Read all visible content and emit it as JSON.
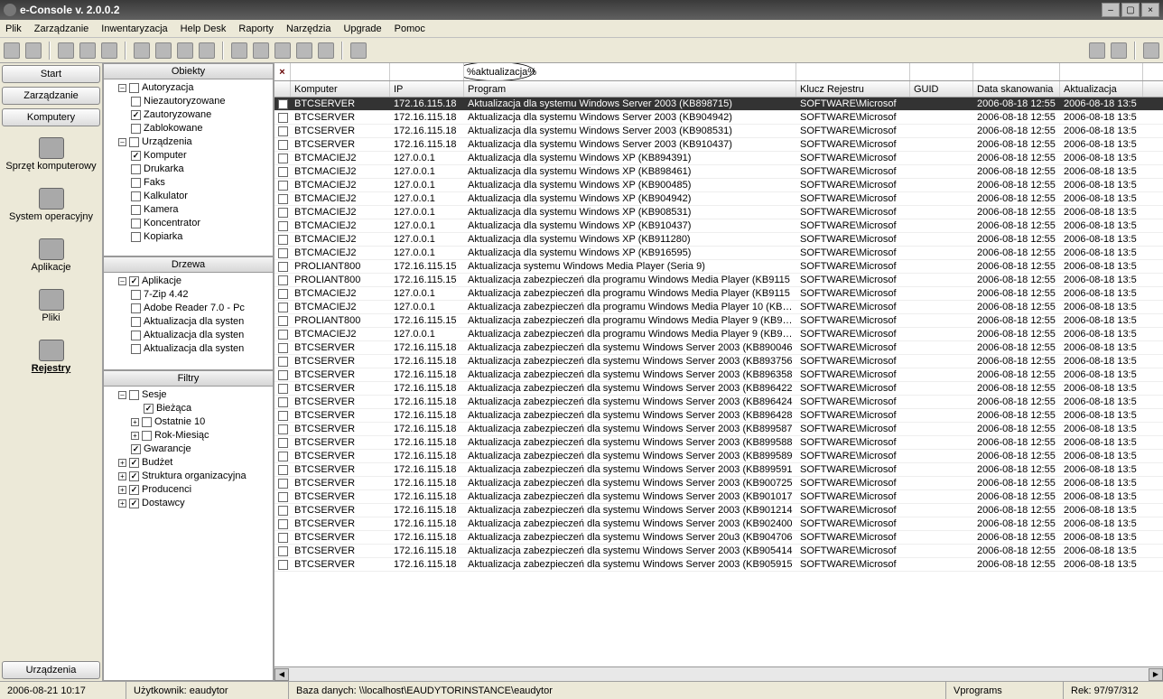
{
  "title": "e-Console v. 2.0.0.2",
  "menu": [
    "Plik",
    "Zarządzanie",
    "Inwentaryzacja",
    "Help Desk",
    "Raporty",
    "Narzędzia",
    "Upgrade",
    "Pomoc"
  ],
  "leftButtons": {
    "start": "Start",
    "zarz": "Zarządzanie",
    "komp": "Komputery",
    "urz": "Urządzenia"
  },
  "leftBig": [
    {
      "id": "sprzet",
      "label": "Sprzęt komputerowy"
    },
    {
      "id": "system",
      "label": "System operacyjny"
    },
    {
      "id": "aplikacje",
      "label": "Aplikacje"
    },
    {
      "id": "pliki",
      "label": "Pliki"
    },
    {
      "id": "rejestry",
      "label": "Rejestry",
      "selected": true
    }
  ],
  "panels": {
    "obiekty": {
      "title": "Obiekty",
      "root": "Autoryzacja",
      "authItems": [
        {
          "label": "Niezautoryzowane",
          "on": false
        },
        {
          "label": "Zautoryzowane",
          "on": true
        },
        {
          "label": "Zablokowane",
          "on": false
        }
      ],
      "urz": "Urządzenia",
      "urzItems": [
        {
          "label": "Komputer",
          "on": true
        },
        {
          "label": "Drukarka",
          "on": false
        },
        {
          "label": "Faks",
          "on": false
        },
        {
          "label": "Kalkulator",
          "on": false
        },
        {
          "label": "Kamera",
          "on": false
        },
        {
          "label": "Koncentrator",
          "on": false
        },
        {
          "label": "Kopiarka",
          "on": false
        }
      ]
    },
    "drzewa": {
      "title": "Drzewa",
      "root": "Aplikacje",
      "items": [
        {
          "label": "7-Zip 4.42",
          "on": false
        },
        {
          "label": "Adobe Reader 7.0 - Pc",
          "on": false
        },
        {
          "label": "Aktualizacja dla systen",
          "on": false
        },
        {
          "label": "Aktualizacja dla systen",
          "on": false
        },
        {
          "label": "Aktualizacja dla systen",
          "on": false
        }
      ]
    },
    "filtry": {
      "title": "Filtry",
      "sesje": "Sesje",
      "sesItems": [
        {
          "label": "Bieżąca",
          "on": true,
          "leaf": true
        },
        {
          "label": "Ostatnie 10",
          "on": false,
          "exp": "+"
        },
        {
          "label": "Rok-Miesiąc",
          "on": false,
          "exp": "+"
        }
      ],
      "rest": [
        {
          "label": "Gwarancje",
          "on": true,
          "exp": ""
        },
        {
          "label": "Budżet",
          "on": true,
          "exp": "+"
        },
        {
          "label": "Struktura organizacyjna",
          "on": true,
          "exp": "+"
        },
        {
          "label": "Producenci",
          "on": true,
          "exp": "+"
        },
        {
          "label": "Dostawcy",
          "on": true,
          "exp": "+"
        }
      ]
    }
  },
  "filterVal": "%aktualizacja%",
  "columns": [
    "Komputer",
    "IP",
    "Program",
    "Klucz Rejestru",
    "GUID",
    "Data skanowania",
    "Aktualizacja"
  ],
  "rows": [
    {
      "sel": true,
      "c": [
        "BTCSERVER",
        "172.16.115.18",
        "Aktualizacja dla systemu Windows Server 2003 (KB898715)",
        "SOFTWARE\\Microsof",
        "",
        "2006-08-18 12:55",
        "2006-08-18 13:5"
      ]
    },
    {
      "c": [
        "BTCSERVER",
        "172.16.115.18",
        "Aktualizacja dla systemu Windows Server 2003 (KB904942)",
        "SOFTWARE\\Microsof",
        "",
        "2006-08-18 12:55",
        "2006-08-18 13:5"
      ]
    },
    {
      "c": [
        "BTCSERVER",
        "172.16.115.18",
        "Aktualizacja dla systemu Windows Server 2003 (KB908531)",
        "SOFTWARE\\Microsof",
        "",
        "2006-08-18 12:55",
        "2006-08-18 13:5"
      ]
    },
    {
      "c": [
        "BTCSERVER",
        "172.16.115.18",
        "Aktualizacja dla systemu Windows Server 2003 (KB910437)",
        "SOFTWARE\\Microsof",
        "",
        "2006-08-18 12:55",
        "2006-08-18 13:5"
      ]
    },
    {
      "c": [
        "BTCMACIEJ2",
        "127.0.0.1",
        "Aktualizacja dla systemu Windows XP (KB894391)",
        "SOFTWARE\\Microsof",
        "",
        "2006-08-18 12:55",
        "2006-08-18 13:5"
      ]
    },
    {
      "c": [
        "BTCMACIEJ2",
        "127.0.0.1",
        "Aktualizacja dla systemu Windows XP (KB898461)",
        "SOFTWARE\\Microsof",
        "",
        "2006-08-18 12:55",
        "2006-08-18 13:5"
      ]
    },
    {
      "c": [
        "BTCMACIEJ2",
        "127.0.0.1",
        "Aktualizacja dla systemu Windows XP (KB900485)",
        "SOFTWARE\\Microsof",
        "",
        "2006-08-18 12:55",
        "2006-08-18 13:5"
      ]
    },
    {
      "c": [
        "BTCMACIEJ2",
        "127.0.0.1",
        "Aktualizacja dla systemu Windows XP (KB904942)",
        "SOFTWARE\\Microsof",
        "",
        "2006-08-18 12:55",
        "2006-08-18 13:5"
      ]
    },
    {
      "c": [
        "BTCMACIEJ2",
        "127.0.0.1",
        "Aktualizacja dla systemu Windows XP (KB908531)",
        "SOFTWARE\\Microsof",
        "",
        "2006-08-18 12:55",
        "2006-08-18 13:5"
      ]
    },
    {
      "c": [
        "BTCMACIEJ2",
        "127.0.0.1",
        "Aktualizacja dla systemu Windows XP (KB910437)",
        "SOFTWARE\\Microsof",
        "",
        "2006-08-18 12:55",
        "2006-08-18 13:5"
      ]
    },
    {
      "c": [
        "BTCMACIEJ2",
        "127.0.0.1",
        "Aktualizacja dla systemu Windows XP (KB911280)",
        "SOFTWARE\\Microsof",
        "",
        "2006-08-18 12:55",
        "2006-08-18 13:5"
      ]
    },
    {
      "c": [
        "BTCMACIEJ2",
        "127.0.0.1",
        "Aktualizacja dla systemu Windows XP (KB916595)",
        "SOFTWARE\\Microsof",
        "",
        "2006-08-18 12:55",
        "2006-08-18 13:5"
      ]
    },
    {
      "c": [
        "PROLIANT800",
        "172.16.115.15",
        "Aktualizacja systemu Windows Media Player (Seria 9)",
        "SOFTWARE\\Microsof",
        "",
        "2006-08-18 12:55",
        "2006-08-18 13:5"
      ]
    },
    {
      "c": [
        "PROLIANT800",
        "172.16.115.15",
        "Aktualizacja zabezpieczeń dla programu Windows Media Player (KB9115",
        "SOFTWARE\\Microsof",
        "",
        "2006-08-18 12:55",
        "2006-08-18 13:5"
      ]
    },
    {
      "c": [
        "BTCMACIEJ2",
        "127.0.0.1",
        "Aktualizacja zabezpieczeń dla programu Windows Media Player (KB9115",
        "SOFTWARE\\Microsof",
        "",
        "2006-08-18 12:55",
        "2006-08-18 13:5"
      ]
    },
    {
      "c": [
        "BTCMACIEJ2",
        "127.0.0.1",
        "Aktualizacja zabezpieczeń dla programu Windows Media Player 10 (KB91",
        "SOFTWARE\\Microsof",
        "",
        "2006-08-18 12:55",
        "2006-08-18 13:5"
      ]
    },
    {
      "c": [
        "PROLIANT800",
        "172.16.115.15",
        "Aktualizacja zabezpieczeń dla programu Windows Media Player 9 (KB917",
        "SOFTWARE\\Microsof",
        "",
        "2006-08-18 12:55",
        "2006-08-18 13:5"
      ]
    },
    {
      "c": [
        "BTCMACIEJ2",
        "127.0.0.1",
        "Aktualizacja zabezpieczeń dla programu Windows Media Player 9 (KB917",
        "SOFTWARE\\Microsof",
        "",
        "2006-08-18 12:55",
        "2006-08-18 13:5"
      ]
    },
    {
      "c": [
        "BTCSERVER",
        "172.16.115.18",
        "Aktualizacja zabezpieczeń dla systemu Windows Server 2003 (KB890046",
        "SOFTWARE\\Microsof",
        "",
        "2006-08-18 12:55",
        "2006-08-18 13:5"
      ]
    },
    {
      "c": [
        "BTCSERVER",
        "172.16.115.18",
        "Aktualizacja zabezpieczeń dla systemu Windows Server 2003 (KB893756",
        "SOFTWARE\\Microsof",
        "",
        "2006-08-18 12:55",
        "2006-08-18 13:5"
      ]
    },
    {
      "c": [
        "BTCSERVER",
        "172.16.115.18",
        "Aktualizacja zabezpieczeń dla systemu Windows Server 2003 (KB896358",
        "SOFTWARE\\Microsof",
        "",
        "2006-08-18 12:55",
        "2006-08-18 13:5"
      ]
    },
    {
      "c": [
        "BTCSERVER",
        "172.16.115.18",
        "Aktualizacja zabezpieczeń dla systemu Windows Server 2003 (KB896422",
        "SOFTWARE\\Microsof",
        "",
        "2006-08-18 12:55",
        "2006-08-18 13:5"
      ]
    },
    {
      "c": [
        "BTCSERVER",
        "172.16.115.18",
        "Aktualizacja zabezpieczeń dla systemu Windows Server 2003 (KB896424",
        "SOFTWARE\\Microsof",
        "",
        "2006-08-18 12:55",
        "2006-08-18 13:5"
      ]
    },
    {
      "c": [
        "BTCSERVER",
        "172.16.115.18",
        "Aktualizacja zabezpieczeń dla systemu Windows Server 2003 (KB896428",
        "SOFTWARE\\Microsof",
        "",
        "2006-08-18 12:55",
        "2006-08-18 13:5"
      ]
    },
    {
      "c": [
        "BTCSERVER",
        "172.16.115.18",
        "Aktualizacja zabezpieczeń dla systemu Windows Server 2003 (KB899587",
        "SOFTWARE\\Microsof",
        "",
        "2006-08-18 12:55",
        "2006-08-18 13:5"
      ]
    },
    {
      "c": [
        "BTCSERVER",
        "172.16.115.18",
        "Aktualizacja zabezpieczeń dla systemu Windows Server 2003 (KB899588",
        "SOFTWARE\\Microsof",
        "",
        "2006-08-18 12:55",
        "2006-08-18 13:5"
      ]
    },
    {
      "c": [
        "BTCSERVER",
        "172.16.115.18",
        "Aktualizacja zabezpieczeń dla systemu Windows Server 2003 (KB899589",
        "SOFTWARE\\Microsof",
        "",
        "2006-08-18 12:55",
        "2006-08-18 13:5"
      ]
    },
    {
      "c": [
        "BTCSERVER",
        "172.16.115.18",
        "Aktualizacja zabezpieczeń dla systemu Windows Server 2003 (KB899591",
        "SOFTWARE\\Microsof",
        "",
        "2006-08-18 12:55",
        "2006-08-18 13:5"
      ]
    },
    {
      "c": [
        "BTCSERVER",
        "172.16.115.18",
        "Aktualizacja zabezpieczeń dla systemu Windows Server 2003 (KB900725",
        "SOFTWARE\\Microsof",
        "",
        "2006-08-18 12:55",
        "2006-08-18 13:5"
      ]
    },
    {
      "c": [
        "BTCSERVER",
        "172.16.115.18",
        "Aktualizacja zabezpieczeń dla systemu Windows Server 2003 (KB901017",
        "SOFTWARE\\Microsof",
        "",
        "2006-08-18 12:55",
        "2006-08-18 13:5"
      ]
    },
    {
      "c": [
        "BTCSERVER",
        "172.16.115.18",
        "Aktualizacja zabezpieczeń dla systemu Windows Server 2003 (KB901214",
        "SOFTWARE\\Microsof",
        "",
        "2006-08-18 12:55",
        "2006-08-18 13:5"
      ]
    },
    {
      "c": [
        "BTCSERVER",
        "172.16.115.18",
        "Aktualizacja zabezpieczeń dla systemu Windows Server 2003 (KB902400",
        "SOFTWARE\\Microsof",
        "",
        "2006-08-18 12:55",
        "2006-08-18 13:5"
      ]
    },
    {
      "c": [
        "BTCSERVER",
        "172.16.115.18",
        "Aktualizacja zabezpieczeń dla systemu Windows Server 20u3 (KB904706",
        "SOFTWARE\\Microsof",
        "",
        "2006-08-18 12:55",
        "2006-08-18 13:5"
      ]
    },
    {
      "c": [
        "BTCSERVER",
        "172.16.115.18",
        "Aktualizacja zabezpieczeń dla systemu Windows Server 2003 (KB905414",
        "SOFTWARE\\Microsof",
        "",
        "2006-08-18 12:55",
        "2006-08-18 13:5"
      ]
    },
    {
      "c": [
        "BTCSERVER",
        "172.16.115.18",
        "Aktualizacja zabezpieczeń dla systemu Windows Server 2003 (KB905915",
        "SOFTWARE\\Microsof",
        "",
        "2006-08-18 12:55",
        "2006-08-18 13:5"
      ]
    }
  ],
  "status": {
    "time": "2006-08-21 10:17",
    "user": "Użytkownik: eaudytor",
    "db": "Baza danych: \\\\localhost\\EAUDYTORINSTANCE\\eaudytor",
    "vprog": "Vprograms",
    "rek": "Rek: 97/97/312"
  }
}
